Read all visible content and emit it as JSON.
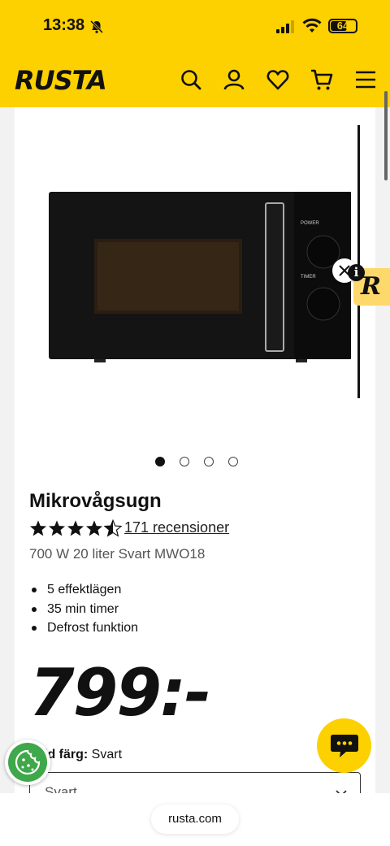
{
  "status_bar": {
    "time": "13:38",
    "battery": "64",
    "icons": [
      "bell-slash-icon",
      "signal-icon",
      "wifi-icon",
      "battery-icon"
    ]
  },
  "header": {
    "logo": "RUSTA",
    "icons": [
      "search-icon",
      "user-icon",
      "heart-icon",
      "cart-icon",
      "menu-icon"
    ]
  },
  "gallery": {
    "image_count": 4,
    "active_index": 0
  },
  "product": {
    "title": "Mikrovågsugn",
    "rating": 4.5,
    "rating_max": 5,
    "reviews_label": "171 recensioner",
    "subtitle": "700 W 20 liter Svart MWO18",
    "features": [
      "5 effektlägen",
      "35 min timer",
      "Defrost funktion"
    ],
    "price": "799:-",
    "color_label": "ld färg:",
    "color_value": "Svart",
    "select_value": "Svart"
  },
  "widgets": {
    "r_badge": "R",
    "info": "i"
  },
  "bottom_bar": {
    "url": "rusta.com"
  },
  "colors": {
    "brand_yellow": "#fdd000",
    "text": "#111111",
    "cookie_green": "#3fa84a"
  }
}
